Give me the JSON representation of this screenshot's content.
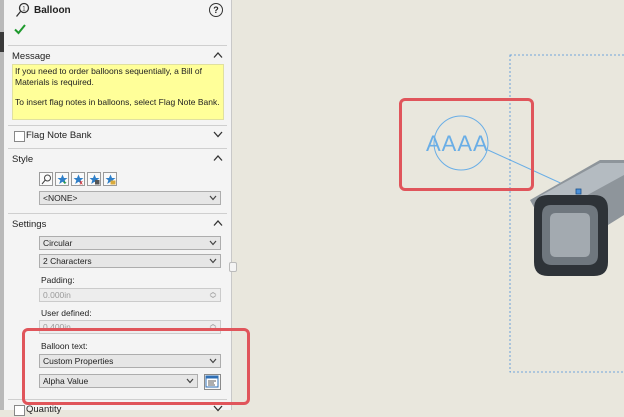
{
  "panel": {
    "title": "Balloon",
    "help_glyph": "?",
    "message": {
      "header": "Message",
      "line1": "If you need to order balloons sequentially, a Bill of Materials is required.",
      "line2": "To insert flag notes in balloons, select Flag Note Bank."
    },
    "flag_note_bank": {
      "label": "Flag Note Bank",
      "checked": false
    },
    "style": {
      "header": "Style",
      "buttons": [
        "balloon-style-icon",
        "add-style-icon",
        "delete-style-icon",
        "save-style-icon",
        "load-style-icon"
      ],
      "selected": "<NONE>"
    },
    "settings": {
      "header": "Settings",
      "shape": "Circular",
      "size": "2 Characters",
      "padding_label": "Padding:",
      "padding_value": "0.000in",
      "user_defined_label": "User defined:",
      "user_defined_value": "0.400in",
      "balloon_text_label": "Balloon text:",
      "balloon_text_value": "Custom Properties",
      "property_value": "Alpha Value"
    },
    "quantity": {
      "header": "Quantity"
    }
  },
  "viewport": {
    "balloon_text": "AAAA"
  },
  "colors": {
    "highlight": "#e0555b",
    "balloon": "#6aaee6",
    "message_bg": "#ffff99"
  }
}
